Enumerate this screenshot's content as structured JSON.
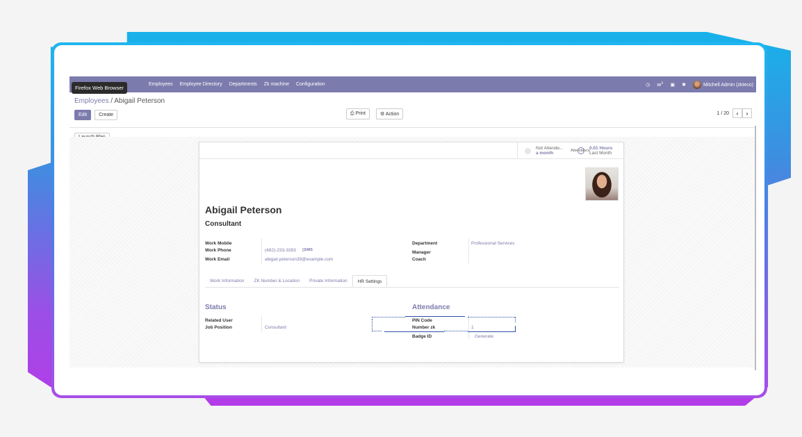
{
  "browser_tooltip": "Firefox Web Browser",
  "nav": {
    "menu": [
      "Employees",
      "Employee Directory",
      "Departments",
      "Zk machine",
      "Configuration"
    ],
    "user": "Mitchell Admin (zkteco)",
    "chat_count": "1"
  },
  "breadcrumb": {
    "parent": "Employees",
    "separator": "/",
    "current": "Abigail Peterson"
  },
  "buttons": {
    "edit": "Edit",
    "create": "Create",
    "print": "Print",
    "action": "Action",
    "launch_plan": "Launch Plan"
  },
  "pager": {
    "text": "1 / 20"
  },
  "smart_buttons": {
    "presence": {
      "line1": "Not Attende...",
      "line2": "a month"
    },
    "hours": {
      "line1": "0.01 Hours",
      "line2": "Last Month",
      "overlay": "Attendance"
    }
  },
  "employee": {
    "name": "Abigail Peterson",
    "job_title": "Consultant",
    "work_mobile_label": "Work Mobile",
    "work_phone_label": "Work Phone",
    "work_phone": "(482)-233-3393",
    "sms": "SMS",
    "work_email_label": "Work Email",
    "work_email": "abigail.peterson39@example.com",
    "department_label": "Department",
    "department": "Professional Services",
    "manager_label": "Manager",
    "coach_label": "Coach"
  },
  "tabs": [
    "Work Information",
    "ZK Number & Location",
    "Private Information",
    "HR Settings"
  ],
  "hr": {
    "status_title": "Status",
    "related_user_label": "Related User",
    "job_position_label": "Job Position",
    "job_position": "Consultant",
    "attendance_title": "Attendance",
    "pin_label": "PIN Code",
    "number_zk_label": "Number zk",
    "number_zk": "1",
    "badge_label": "Badge ID",
    "generate": "Generate"
  },
  "colors": {
    "brand": "#7c7bad",
    "highlight": "#2b4fa8"
  }
}
